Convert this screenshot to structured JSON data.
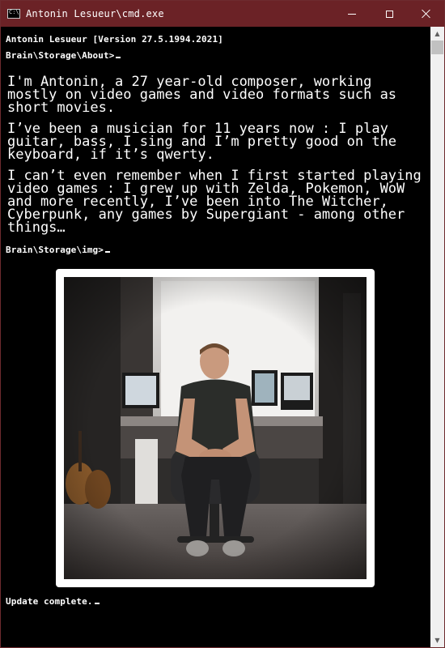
{
  "window": {
    "title": "Antonin Lesueur\\cmd.exe",
    "controls": {
      "minimize_icon": "minimize-icon",
      "maximize_icon": "maximize-icon",
      "close_icon": "close-icon"
    }
  },
  "console": {
    "version_line": "Antonin Lesueur [Version 27.5.1994.2021]",
    "prompt_about": "Brain\\Storage\\About>",
    "paragraphs": [
      "I'm Antonin, a 27 year-old composer, working mostly on video games and video formats such as short movies.",
      "I’ve been a musician for 11 years now : I play guitar, bass, I sing and I’m pretty good on the keyboard, if it’s qwerty.",
      "I can’t even remember when I first started playing video games : I grew up with Zelda, Pokemon, WoW and more recently, I’ve been into The Witcher, Cyberpunk, any games by Supergiant - among other things…"
    ],
    "prompt_img": "Brain\\Storage\\img>",
    "status": "Update complete."
  },
  "colors": {
    "titlebar": "#6b2226",
    "console_bg": "#000000",
    "console_text": "#ffffff"
  }
}
